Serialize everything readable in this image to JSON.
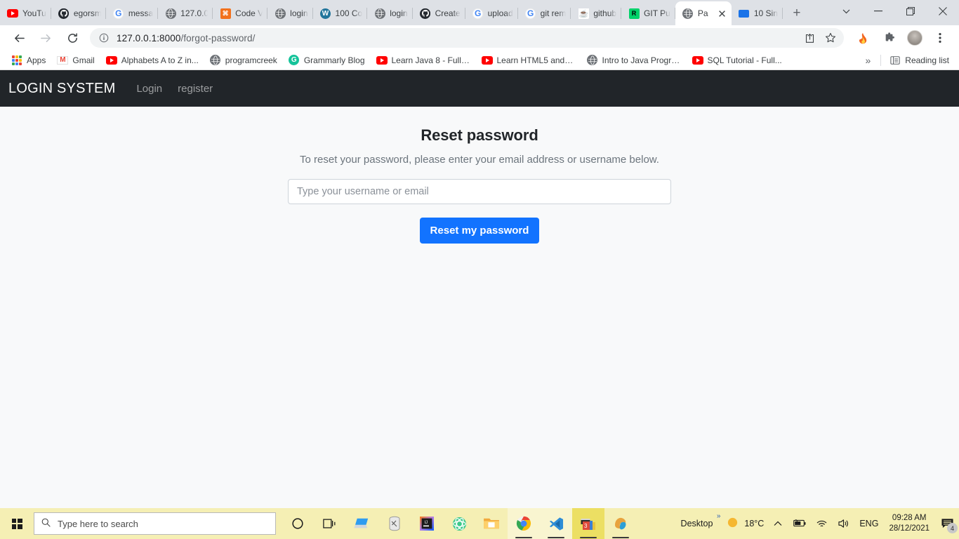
{
  "browser": {
    "tabs": [
      {
        "title": "YouTu",
        "icon": "youtube-icon",
        "active": false
      },
      {
        "title": "egorsm",
        "icon": "github-icon",
        "active": false
      },
      {
        "title": "messa",
        "icon": "google-icon",
        "active": false
      },
      {
        "title": "127.0.0",
        "icon": "globe-icon",
        "active": false
      },
      {
        "title": "Code V",
        "icon": "code-icon",
        "active": false
      },
      {
        "title": "login",
        "icon": "globe-icon",
        "active": false
      },
      {
        "title": "100 Co",
        "icon": "wordpress-icon",
        "active": false
      },
      {
        "title": "login",
        "icon": "globe-icon",
        "active": false
      },
      {
        "title": "Create",
        "icon": "github-icon",
        "active": false
      },
      {
        "title": "upload",
        "icon": "google-icon",
        "active": false
      },
      {
        "title": "git rem",
        "icon": "google-icon",
        "active": false
      },
      {
        "title": "github",
        "icon": "java-icon",
        "active": false
      },
      {
        "title": "GIT Pu",
        "icon": "green-icon",
        "active": false
      },
      {
        "title": "Pa",
        "icon": "globe-icon",
        "active": true
      },
      {
        "title": "10 Sin",
        "icon": "blue-icon",
        "active": false
      }
    ],
    "new_tab_label": "+",
    "window_controls": {
      "tab_search": "chevron-down",
      "minimize": "minimize",
      "maximize": "maximize",
      "close": "close"
    },
    "toolbar": {
      "back_label": "←",
      "forward_label": "→",
      "reload_label": "⟳",
      "url_host": "127.0.0.1:8000",
      "url_path": "/forgot-password/",
      "url_full": "127.0.0.1:8000/forgot-password/",
      "site_info_icon": "info-circle-icon",
      "share_icon": "share-icon",
      "bookmark_icon": "star-icon",
      "extension_flame_icon": "flame-icon",
      "extensions_icon": "puzzle-icon",
      "profile_icon": "avatar",
      "menu_icon": "three-dot-menu-icon"
    },
    "bookmarks": [
      {
        "label": "Apps",
        "icon": "apps-grid-icon"
      },
      {
        "label": "Gmail",
        "icon": "gmail-icon"
      },
      {
        "label": "Alphabets A to Z in...",
        "icon": "youtube-icon"
      },
      {
        "label": "programcreek",
        "icon": "globe-icon"
      },
      {
        "label": "Grammarly Blog",
        "icon": "grammarly-icon"
      },
      {
        "label": "Learn Java 8 - Full T...",
        "icon": "youtube-icon"
      },
      {
        "label": "Learn HTML5 and C...",
        "icon": "youtube-icon"
      },
      {
        "label": "Intro to Java Progra...",
        "icon": "globe-icon"
      },
      {
        "label": "SQL Tutorial - Full...",
        "icon": "youtube-icon"
      }
    ],
    "bookmarks_overflow": "»",
    "reading_list_label": "Reading list"
  },
  "page": {
    "navbar": {
      "brand": "LOGIN SYSTEM",
      "links": [
        {
          "label": "Login"
        },
        {
          "label": "register"
        }
      ]
    },
    "reset": {
      "title": "Reset password",
      "subtitle": "To reset your password, please enter your email address or username below.",
      "input_value": "",
      "input_placeholder": "Type your username or email",
      "submit_label": "Reset my password",
      "accent_color": "#1273ff",
      "background_color": "#f8f9fa",
      "navbar_color": "#212529"
    }
  },
  "taskbar": {
    "start_label": "start-button",
    "search_placeholder": "Type here to search",
    "search_icon": "magnifier-icon",
    "items": [
      {
        "name": "cortana-icon",
        "glyph": "◯"
      },
      {
        "name": "task-view-icon",
        "glyph": "❑"
      },
      {
        "name": "remote-desktop-icon",
        "glyph": "💻"
      },
      {
        "name": "mysql-workbench-icon",
        "glyph": "🗄"
      },
      {
        "name": "intellij-idea-icon",
        "glyph": "IJ"
      },
      {
        "name": "atom-editor-icon",
        "glyph": "⚛"
      },
      {
        "name": "file-explorer-icon",
        "glyph": "🗂"
      },
      {
        "name": "google-chrome-icon",
        "glyph": "◉"
      },
      {
        "name": "vs-code-icon",
        "glyph": "✕"
      },
      {
        "name": "movie-maker-icon",
        "glyph": "🎬"
      },
      {
        "name": "edge-browser-icon",
        "glyph": "◐"
      }
    ],
    "desktop_label": "Desktop",
    "desktop_overflow": "»",
    "weather_temp": "18°C",
    "weather_icon": "sun-icon",
    "tray_chevron": "^",
    "battery_icon": "battery-icon",
    "wifi_icon": "wifi-icon",
    "volume_icon": "speaker-icon",
    "language": "ENG",
    "time": "09:28 AM",
    "date": "28/12/2021",
    "notification_icon": "notification-icon",
    "notification_count": "4"
  }
}
